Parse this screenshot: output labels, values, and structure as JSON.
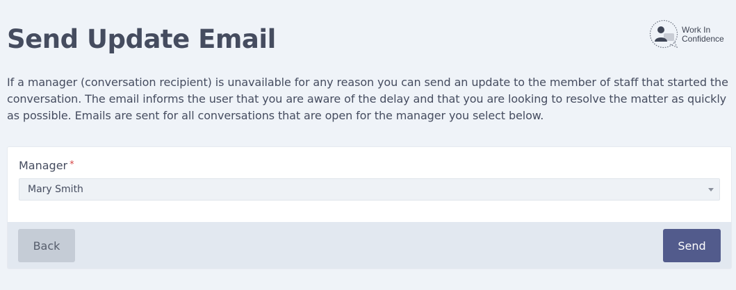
{
  "page": {
    "title": "Send Update Email",
    "description": "If a manager (conversation recipient) is unavailable for any reason you can send an update to the member of staff that started the conversation. The email informs the user that you are aware of the delay and that you are looking to resolve the matter as quickly as possible. Emails are sent for all conversations that are open for the manager you select below."
  },
  "logo": {
    "line1": "Work In",
    "line2": "Confidence",
    "icon": "person-speech-bubble-icon"
  },
  "form": {
    "manager_label": "Manager",
    "required_marker": "*",
    "manager_value": "Mary Smith"
  },
  "actions": {
    "back_label": "Back",
    "send_label": "Send"
  },
  "colors": {
    "page_background": "#eff3f8",
    "primary_button": "#525b8c",
    "secondary_button": "#c5ccd6",
    "required": "#d64545"
  }
}
